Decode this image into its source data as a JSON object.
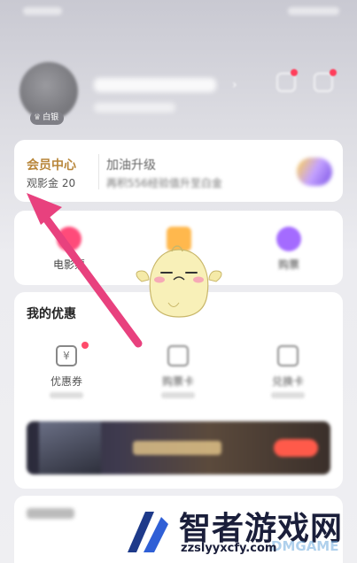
{
  "profile": {
    "badge_label": "白银"
  },
  "vip": {
    "title": "会员中心",
    "subtitle": "观影金 20",
    "upgrade_title": "加油升级",
    "upgrade_sub": "再积556经验值升至白金"
  },
  "functions": [
    {
      "label": "电影票"
    },
    {
      "label": ""
    },
    {
      "label": "购票"
    }
  ],
  "offers": {
    "title": "我的优惠",
    "items": [
      {
        "label": "优惠券"
      },
      {
        "label": "购票卡"
      },
      {
        "label": "兑换卡"
      }
    ]
  },
  "watermark": {
    "title": "智者游戏网",
    "url": "zzslyyxcfy.com",
    "ghost": "DMGAME"
  },
  "colors": {
    "accent_gold": "#b8863a",
    "arrow_pink": "#e8417e",
    "badge_red": "#ff4b6b"
  }
}
